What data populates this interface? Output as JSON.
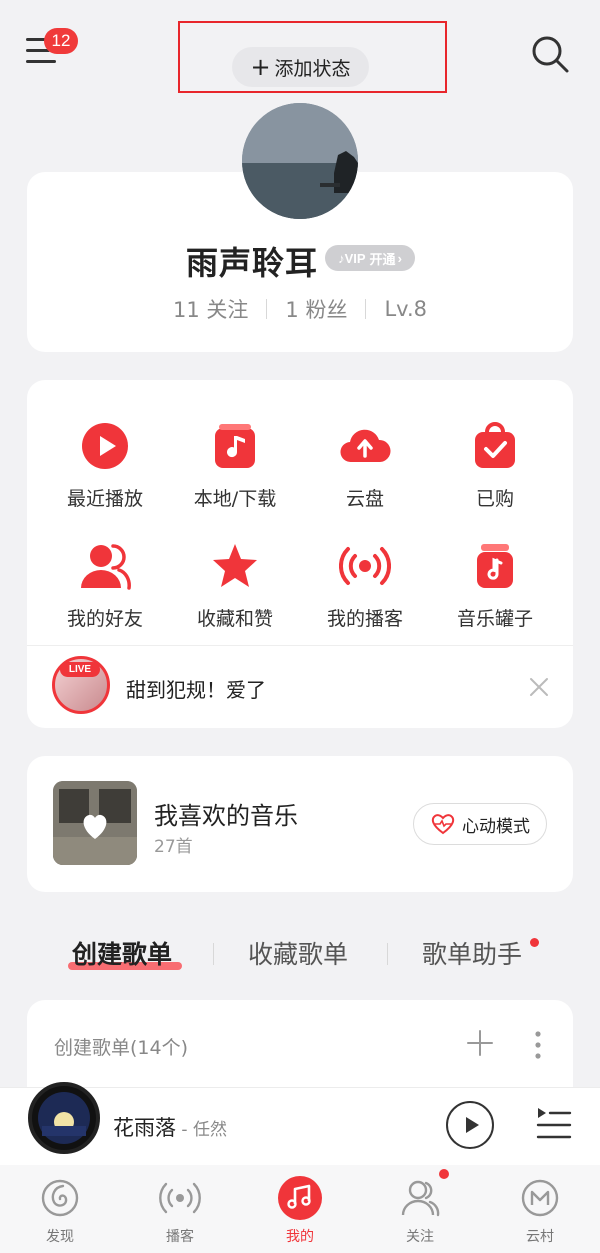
{
  "header": {
    "menu_badge": "12",
    "add_status_label": "添加状态"
  },
  "profile": {
    "username": "雨声聆耳",
    "vip_label": "开通",
    "stats": {
      "following": "11 关注",
      "followers": "1 粉丝",
      "level": "Lv.8"
    }
  },
  "quick_grid": {
    "items": [
      {
        "label": "最近播放",
        "icon": "play-circle-icon"
      },
      {
        "label": "本地/下载",
        "icon": "music-note-icon"
      },
      {
        "label": "云盘",
        "icon": "cloud-upload-icon"
      },
      {
        "label": "已购",
        "icon": "shopping-bag-check-icon"
      },
      {
        "label": "我的好友",
        "icon": "friends-icon"
      },
      {
        "label": "收藏和赞",
        "icon": "star-icon"
      },
      {
        "label": "我的播客",
        "icon": "podcast-icon"
      },
      {
        "label": "音乐罐子",
        "icon": "music-jar-icon"
      }
    ],
    "live": {
      "tag": "LIVE",
      "text": "甜到犯规！爱了"
    }
  },
  "liked_music": {
    "title": "我喜欢的音乐",
    "count": "27首",
    "heart_mode_label": "心动模式"
  },
  "playlist_tabs": [
    {
      "label": "创建歌单",
      "active": true
    },
    {
      "label": "收藏歌单",
      "active": false
    },
    {
      "label": "歌单助手",
      "active": false
    }
  ],
  "created_playlists": {
    "title": "创建歌单(14个)"
  },
  "player": {
    "song": "花雨落",
    "artist": " - 任然"
  },
  "bottom_nav": [
    {
      "label": "发现",
      "icon": "discover-icon",
      "active": false
    },
    {
      "label": "播客",
      "icon": "podcast-icon",
      "active": false
    },
    {
      "label": "我的",
      "icon": "music-icon",
      "active": true
    },
    {
      "label": "关注",
      "icon": "follow-icon",
      "active": false
    },
    {
      "label": "云村",
      "icon": "cloud-village-icon",
      "active": false
    }
  ],
  "colors": {
    "accent": "#f0353a",
    "background": "#f2f2f4",
    "card": "#ffffff"
  }
}
